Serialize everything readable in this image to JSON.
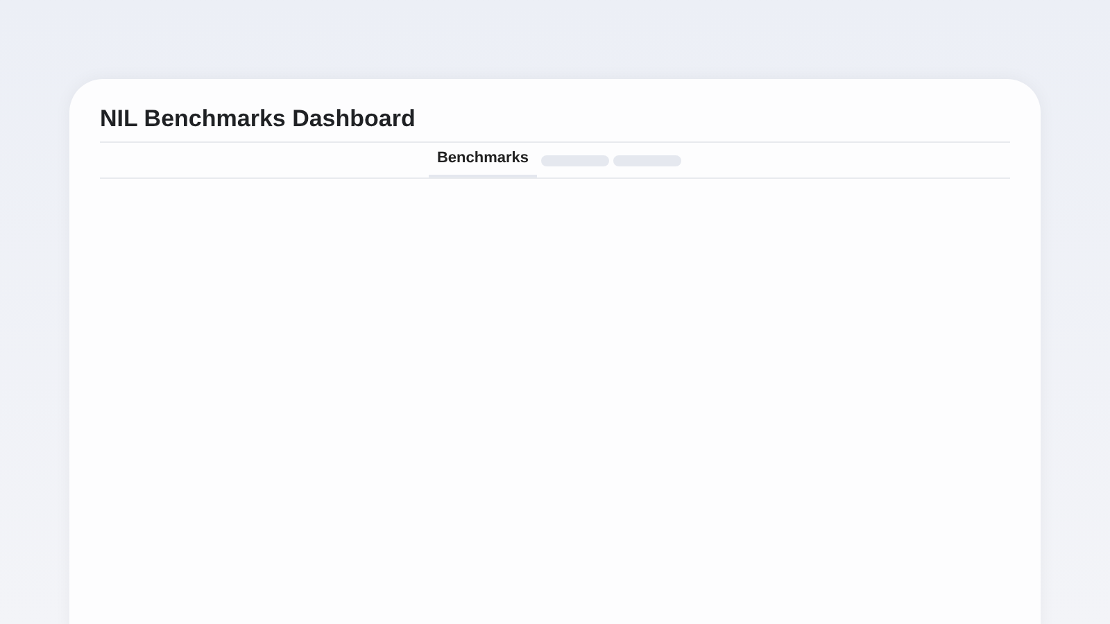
{
  "dashboard": {
    "title": "NIL Benchmarks Dashboard"
  },
  "tabs": [
    {
      "kind": "label",
      "label": "Benchmarks",
      "selected": true
    },
    {
      "kind": "skeleton",
      "selected": false
    },
    {
      "kind": "skeleton",
      "selected": false
    }
  ]
}
